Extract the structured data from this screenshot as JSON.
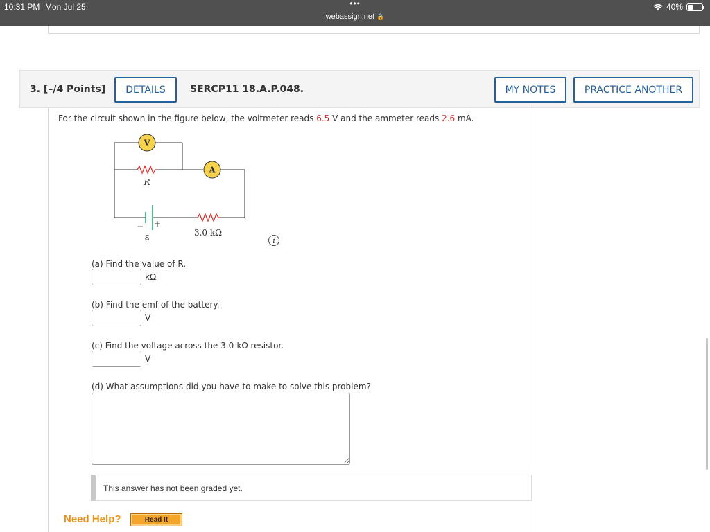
{
  "status": {
    "time": "10:31 PM",
    "date": "Mon Jul 25",
    "dots": "•••",
    "battery": "40%",
    "url": "webassign.net",
    "icons": [
      "wifi-icon",
      "battery-icon",
      "lock-icon"
    ]
  },
  "question": {
    "number": "3.  [–/4 Points]",
    "details_label": "DETAILS",
    "code": "SERCP11 18.A.P.048.",
    "my_notes_label": "MY NOTES",
    "practice_label": "PRACTICE ANOTHER",
    "prompt_before": "For the circuit shown in the figure below, the voltmeter reads ",
    "voltmeter_value": "6.5",
    "prompt_middle": " V and the ammeter reads ",
    "ammeter_value": "2.6",
    "prompt_after": " mA."
  },
  "figure": {
    "voltmeter_label": "V",
    "ammeter_label": "A",
    "resistor_label": "R",
    "emf_label": "ε",
    "minus_label": "−",
    "plus_label": "+",
    "known_resistor_label": "3.0 kΩ",
    "info_label": "i"
  },
  "parts": {
    "a": {
      "text": "(a) Find the value of R.",
      "unit": "kΩ",
      "value": ""
    },
    "b": {
      "text": "(b) Find the emf of the battery.",
      "unit": "V",
      "value": ""
    },
    "c": {
      "text": "(c) Find the voltage across the 3.0-kΩ resistor.",
      "unit": "V",
      "value": ""
    },
    "d": {
      "text": "(d) What assumptions did you have to make to solve this problem?",
      "value": ""
    }
  },
  "graded_message": "This answer has not been graded yet.",
  "help": {
    "need_help": "Need Help?",
    "read_it": "Read It"
  },
  "colors": {
    "accent": "#25619d",
    "highlight_red": "#d32f2f",
    "help_orange": "#e8921a"
  }
}
